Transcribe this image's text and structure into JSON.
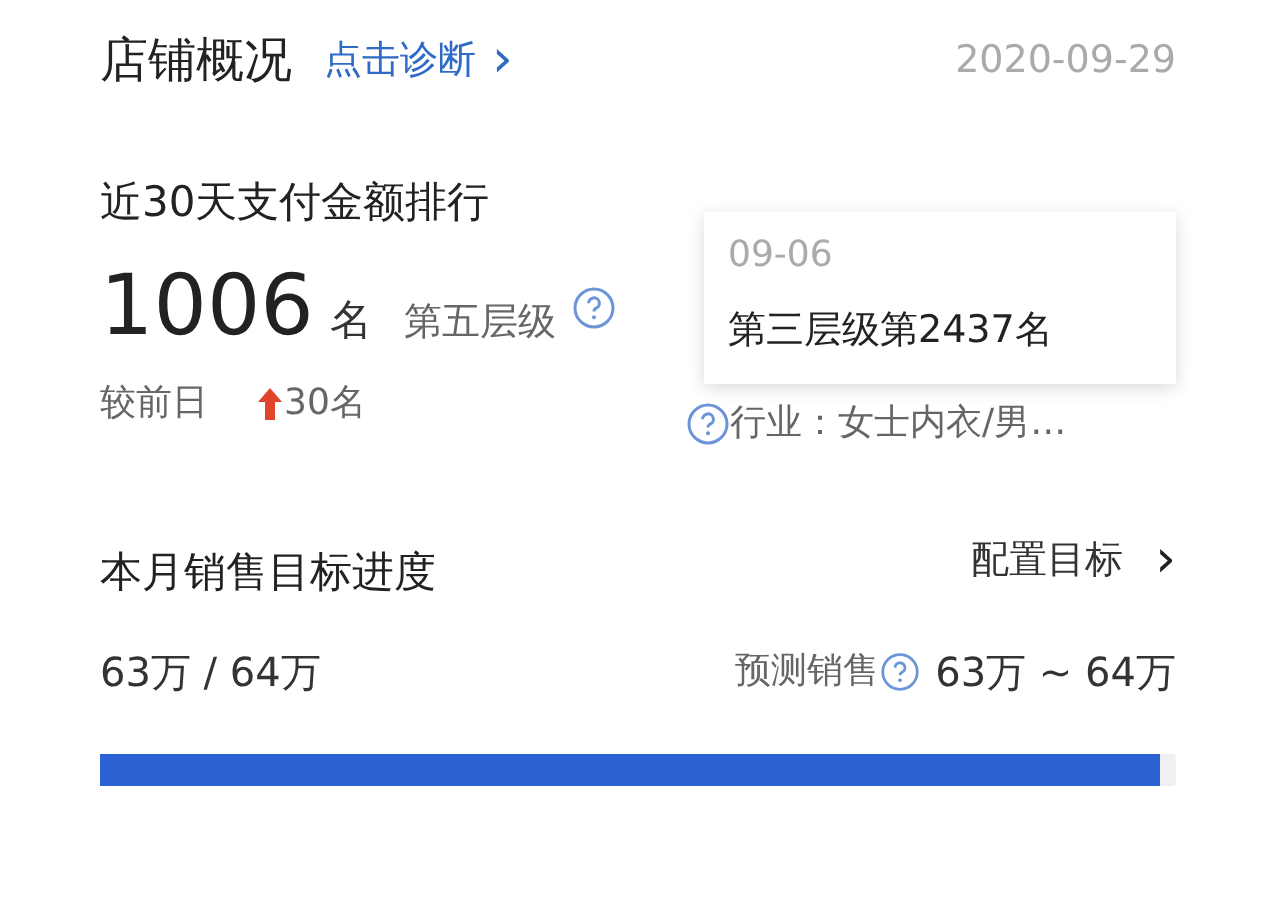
{
  "header": {
    "title": "店铺概况",
    "link": "点击诊断",
    "link_arrow": "›",
    "date": "2020-09-29"
  },
  "ranking": {
    "title": "近30天支付金额排行",
    "rank": "1006",
    "rank_unit": "名",
    "tier": "第五层级",
    "compare_label": "较前日",
    "increase": true,
    "change": "30名",
    "industry": "行业：女士内衣/男…"
  },
  "tooltip": {
    "date": "09-06",
    "text": "第三层级第2437名"
  },
  "target": {
    "title": "本月销售目标进度",
    "config": "配置目标",
    "config_arrow": "›",
    "progress_text": "63万 / 64万",
    "forecast_label": "预测销售",
    "forecast_value": "63万 ~ 64万",
    "level": 0.985
  }
}
